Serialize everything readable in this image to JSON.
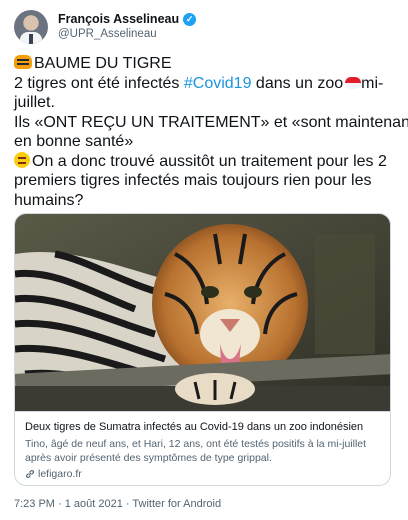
{
  "author": {
    "display_name": "François Asselineau",
    "handle": "@UPR_Asselineau",
    "verified": true
  },
  "tweet": {
    "line1": "BAUME DU TIGRE",
    "line2_a": "2 tigres ont été infectés ",
    "line2_hashtag": "#Covid19",
    "line2_b": " dans un zoo",
    "line2_c": "mi-",
    "line3": "juillet.",
    "line4": "Ils «ONT REÇU UN TRAITEMENT» et «sont maintenant",
    "line5": "en bonne santé»",
    "line6": "On a donc trouvé aussitôt un traitement pour les 2",
    "line7": "premiers tigres infectés mais toujours rien pour les",
    "line8": "humains?"
  },
  "card": {
    "title": "Deux tigres de Sumatra infectés au Covid-19 dans un zoo indonésien",
    "description": "Tino, âgé de neuf ans, et Hari, 12 ans, ont été testés positifs à la mi-juillet après avoir présenté des symptômes de type grippal.",
    "domain": "lefigaro.fr"
  },
  "footer": {
    "timestamp": "7:23 PM · 1 août 2021 · Twitter for Android"
  },
  "icons": [
    "verified-badge-icon",
    "tiger-emoji-icon",
    "indonesia-flag-icon",
    "thinking-emoji-icon",
    "link-icon"
  ],
  "colors": {
    "link": "#1b95e0",
    "verified": "#1da1f2",
    "secondary_text": "#536471",
    "border": "#cfd9de"
  }
}
